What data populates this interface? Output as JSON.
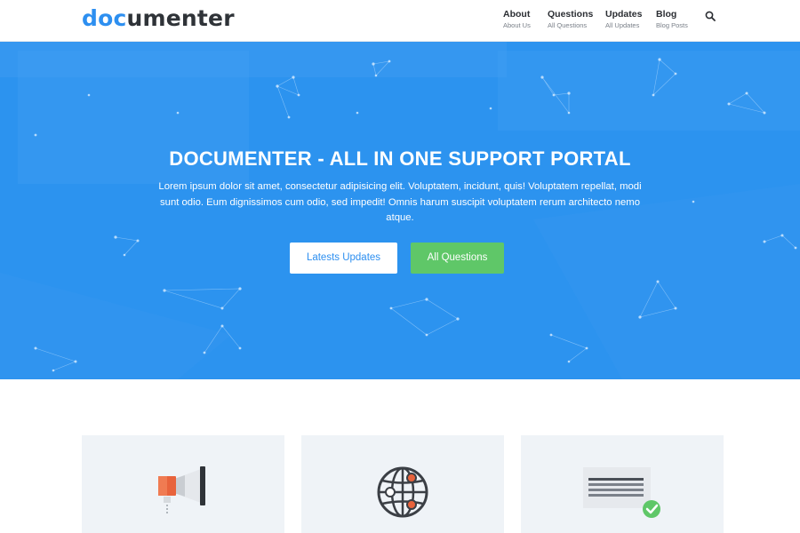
{
  "brand": {
    "logo_part1": "doc",
    "logo_part2": "umenter",
    "accent": "#2d8ff0"
  },
  "nav": [
    {
      "title": "About",
      "subtitle": "About Us"
    },
    {
      "title": "Questions",
      "subtitle": "All Questions"
    },
    {
      "title": "Updates",
      "subtitle": "All Updates"
    },
    {
      "title": "Blog",
      "subtitle": "Blog Posts"
    }
  ],
  "hero": {
    "title": "DOCUMENTER - ALL IN ONE SUPPORT PORTAL",
    "subtitle": "Lorem ipsum dolor sit amet, consectetur adipisicing elit. Voluptatem, incidunt, quis! Voluptatem repellat, modi sunt odio. Eum dignissimos cum odio, sed impedit! Omnis harum suscipit voluptatem rerum architecto nemo atque.",
    "btn_updates": "Latests Updates",
    "btn_questions": "All Questions",
    "bg_color": "#2c93ef",
    "green": "#5fc768"
  },
  "cards": [
    {
      "icon": "megaphone-icon"
    },
    {
      "icon": "globe-network-icon"
    },
    {
      "icon": "document-check-icon"
    }
  ]
}
